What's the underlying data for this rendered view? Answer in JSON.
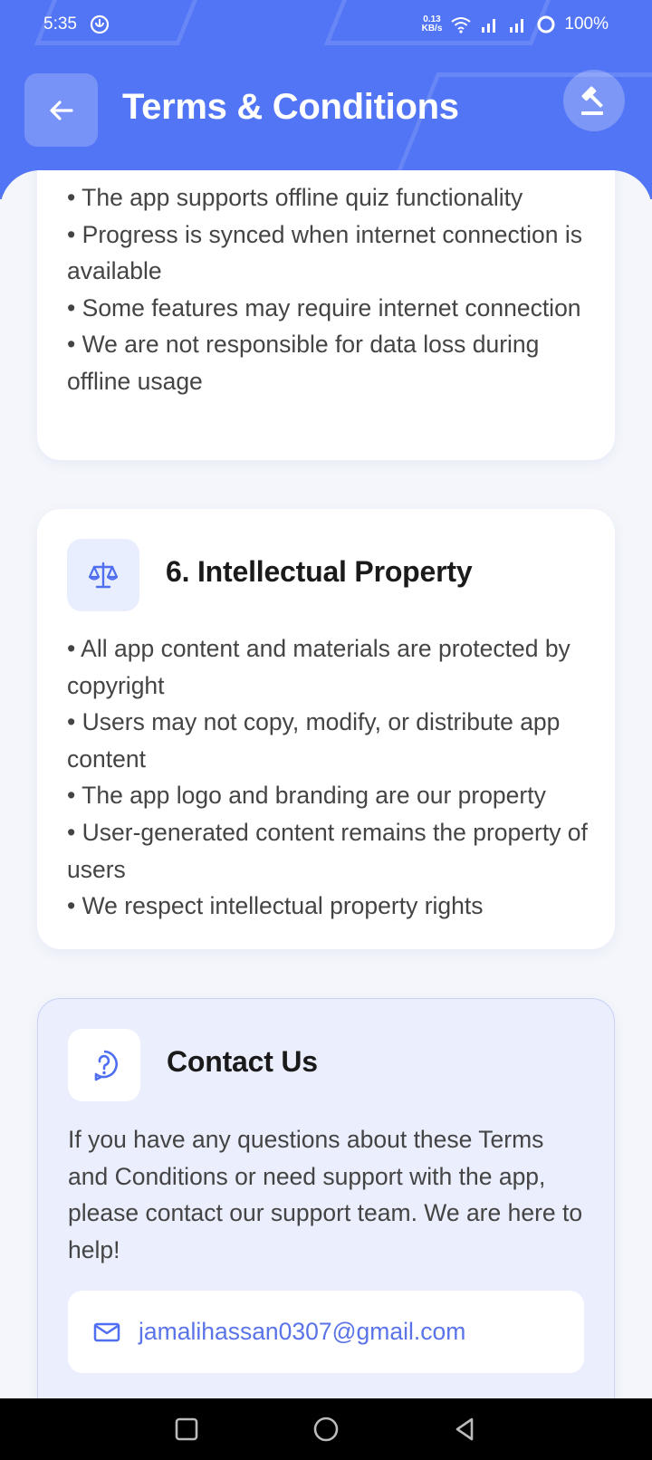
{
  "status_bar": {
    "time": "5:35",
    "speed_value": "0.13",
    "speed_unit": "KB/s",
    "battery": "100%"
  },
  "app_bar": {
    "title": "Terms & Conditions",
    "back_icon": "arrow-left-icon",
    "action_icon": "gavel-icon"
  },
  "sections": {
    "offline": {
      "bullets": [
        "• The app supports offline quiz functionality",
        "• Progress is synced when internet connection is available",
        "• Some features may require internet connection",
        "• We are not responsible for data loss during offline usage"
      ]
    },
    "intellectual_property": {
      "icon": "scale-balance-icon",
      "title": "6. Intellectual Property",
      "bullets": [
        "• All app content and materials are protected by copyright",
        "• Users may not copy, modify, or distribute app content",
        "• The app logo and branding are our property",
        "• User-generated content remains the property of users",
        "• We respect intellectual property rights"
      ]
    },
    "contact": {
      "icon": "help-circle-icon",
      "title": "Contact Us",
      "text": "If you have any questions about these Terms and Conditions or need support with the app, please contact our support team. We are here to help!",
      "email_icon": "mail-icon",
      "email": "jamalihassan0307@gmail.com"
    }
  },
  "colors": {
    "primary": "#5275f5",
    "link": "#5a74e8",
    "contact_bg": "#eaeefd"
  }
}
